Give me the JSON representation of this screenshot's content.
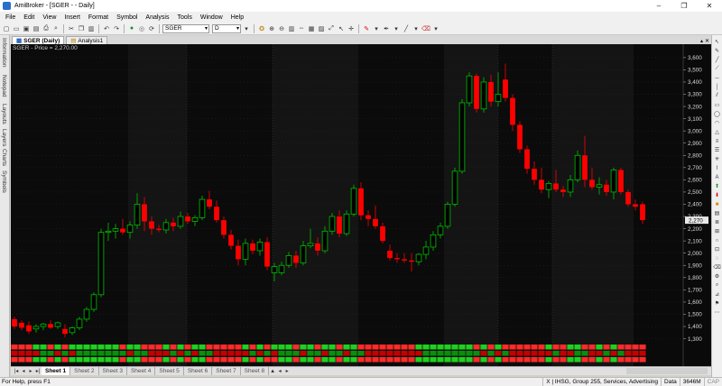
{
  "window": {
    "title": "AmiBroker - [SGER - - Daily]",
    "buttons": [
      "–",
      "❐",
      "✕"
    ]
  },
  "menu": [
    "File",
    "Edit",
    "View",
    "Insert",
    "Format",
    "Symbol",
    "Analysis",
    "Tools",
    "Window",
    "Help"
  ],
  "toolbar": {
    "symbol_value": "SGER",
    "interval_value": "D"
  },
  "left_dock": [
    "Information",
    "Notepad",
    "Layouts",
    "Layers",
    "Charts",
    "Symbols"
  ],
  "doc_tabs": [
    {
      "label": "SGER (Daily)",
      "active": true
    },
    {
      "label": "Analysis1",
      "active": false
    }
  ],
  "chart": {
    "title": "SGER - Price = 2,270.00",
    "last_price_label": "2,270",
    "colors": {
      "up": "#00c000",
      "down": "#ff0000",
      "background": "#0a0a0a"
    }
  },
  "chart_data": {
    "type": "candlestick",
    "title": "SGER - Price = 2,270.00",
    "ylim": [
      1260,
      3680
    ],
    "y_ticks": [
      "1,300",
      "1,400",
      "1,500",
      "1,600",
      "1,700",
      "1,800",
      "1,900",
      "2,000",
      "2,100",
      "2,200",
      "2,300",
      "2,400",
      "2,500",
      "2,600",
      "2,700",
      "2,800",
      "2,900",
      "3,000",
      "3,100",
      "3,200",
      "3,300",
      "3,400",
      "3,500",
      "3,600"
    ],
    "candles": [
      {
        "o": 1460,
        "h": 1480,
        "l": 1380,
        "c": 1400,
        "up": false
      },
      {
        "o": 1430,
        "h": 1450,
        "l": 1370,
        "c": 1390,
        "up": false
      },
      {
        "o": 1410,
        "h": 1440,
        "l": 1340,
        "c": 1360,
        "up": false
      },
      {
        "o": 1380,
        "h": 1420,
        "l": 1350,
        "c": 1400,
        "up": true
      },
      {
        "o": 1400,
        "h": 1430,
        "l": 1370,
        "c": 1420,
        "up": true
      },
      {
        "o": 1420,
        "h": 1450,
        "l": 1380,
        "c": 1390,
        "up": false
      },
      {
        "o": 1400,
        "h": 1440,
        "l": 1380,
        "c": 1430,
        "up": true
      },
      {
        "o": 1380,
        "h": 1420,
        "l": 1310,
        "c": 1340,
        "up": false
      },
      {
        "o": 1350,
        "h": 1400,
        "l": 1330,
        "c": 1390,
        "up": true
      },
      {
        "o": 1390,
        "h": 1480,
        "l": 1370,
        "c": 1460,
        "up": true
      },
      {
        "o": 1460,
        "h": 1560,
        "l": 1440,
        "c": 1540,
        "up": true
      },
      {
        "o": 1540,
        "h": 1680,
        "l": 1520,
        "c": 1660,
        "up": true
      },
      {
        "o": 1660,
        "h": 2200,
        "l": 1640,
        "c": 2170,
        "up": true
      },
      {
        "o": 2170,
        "h": 2250,
        "l": 2100,
        "c": 2180,
        "up": true
      },
      {
        "o": 2180,
        "h": 2240,
        "l": 2120,
        "c": 2200,
        "up": true
      },
      {
        "o": 2200,
        "h": 2280,
        "l": 2150,
        "c": 2170,
        "up": false
      },
      {
        "o": 2170,
        "h": 2260,
        "l": 2120,
        "c": 2230,
        "up": true
      },
      {
        "o": 2230,
        "h": 2490,
        "l": 2200,
        "c": 2400,
        "up": true
      },
      {
        "o": 2400,
        "h": 2460,
        "l": 2180,
        "c": 2260,
        "up": false
      },
      {
        "o": 2260,
        "h": 2300,
        "l": 2150,
        "c": 2200,
        "up": false
      },
      {
        "o": 2200,
        "h": 2230,
        "l": 2170,
        "c": 2190,
        "up": false
      },
      {
        "o": 2190,
        "h": 2280,
        "l": 2160,
        "c": 2250,
        "up": true
      },
      {
        "o": 2250,
        "h": 2290,
        "l": 2180,
        "c": 2220,
        "up": false
      },
      {
        "o": 2220,
        "h": 2340,
        "l": 2200,
        "c": 2300,
        "up": true
      },
      {
        "o": 2300,
        "h": 2330,
        "l": 2240,
        "c": 2260,
        "up": false
      },
      {
        "o": 2260,
        "h": 2310,
        "l": 2220,
        "c": 2290,
        "up": true
      },
      {
        "o": 2290,
        "h": 2470,
        "l": 2270,
        "c": 2440,
        "up": true
      },
      {
        "o": 2440,
        "h": 2510,
        "l": 2360,
        "c": 2380,
        "up": false
      },
      {
        "o": 2380,
        "h": 2430,
        "l": 2250,
        "c": 2270,
        "up": false
      },
      {
        "o": 2270,
        "h": 2300,
        "l": 2120,
        "c": 2150,
        "up": false
      },
      {
        "o": 2150,
        "h": 2190,
        "l": 2030,
        "c": 2060,
        "up": false
      },
      {
        "o": 2060,
        "h": 2110,
        "l": 1900,
        "c": 1950,
        "up": false
      },
      {
        "o": 1950,
        "h": 2120,
        "l": 1900,
        "c": 2080,
        "up": true
      },
      {
        "o": 2080,
        "h": 2110,
        "l": 1990,
        "c": 2020,
        "up": false
      },
      {
        "o": 2020,
        "h": 2120,
        "l": 1980,
        "c": 2090,
        "up": true
      },
      {
        "o": 2090,
        "h": 2130,
        "l": 1860,
        "c": 1890,
        "up": false
      },
      {
        "o": 1890,
        "h": 1920,
        "l": 1770,
        "c": 1840,
        "up": true
      },
      {
        "o": 1840,
        "h": 1930,
        "l": 1820,
        "c": 1900,
        "up": true
      },
      {
        "o": 1900,
        "h": 2010,
        "l": 1880,
        "c": 1980,
        "up": true
      },
      {
        "o": 1980,
        "h": 2020,
        "l": 1880,
        "c": 1920,
        "up": false
      },
      {
        "o": 1920,
        "h": 2100,
        "l": 1900,
        "c": 2060,
        "up": true
      },
      {
        "o": 2060,
        "h": 2200,
        "l": 2040,
        "c": 2080,
        "up": true
      },
      {
        "o": 2080,
        "h": 2130,
        "l": 1980,
        "c": 2020,
        "up": false
      },
      {
        "o": 2020,
        "h": 2220,
        "l": 2000,
        "c": 2180,
        "up": true
      },
      {
        "o": 2180,
        "h": 2330,
        "l": 2150,
        "c": 2300,
        "up": true
      },
      {
        "o": 2300,
        "h": 2350,
        "l": 2130,
        "c": 2160,
        "up": false
      },
      {
        "o": 2160,
        "h": 2350,
        "l": 2140,
        "c": 2320,
        "up": true
      },
      {
        "o": 2320,
        "h": 2560,
        "l": 2300,
        "c": 2530,
        "up": true
      },
      {
        "o": 2530,
        "h": 2580,
        "l": 2270,
        "c": 2310,
        "up": false
      },
      {
        "o": 2310,
        "h": 2350,
        "l": 2220,
        "c": 2280,
        "up": false
      },
      {
        "o": 2280,
        "h": 2390,
        "l": 2200,
        "c": 2220,
        "up": false
      },
      {
        "o": 2220,
        "h": 2250,
        "l": 2080,
        "c": 2100,
        "up": false
      },
      {
        "o": 2020,
        "h": 2070,
        "l": 1940,
        "c": 1960,
        "up": false
      },
      {
        "o": 1960,
        "h": 2000,
        "l": 1920,
        "c": 1950,
        "up": false
      },
      {
        "o": 1950,
        "h": 2000,
        "l": 1920,
        "c": 1940,
        "up": false
      },
      {
        "o": 1940,
        "h": 2000,
        "l": 1850,
        "c": 1930,
        "up": false
      },
      {
        "o": 1930,
        "h": 2000,
        "l": 1900,
        "c": 1990,
        "up": true
      },
      {
        "o": 1990,
        "h": 2100,
        "l": 1950,
        "c": 2050,
        "up": true
      },
      {
        "o": 2050,
        "h": 2180,
        "l": 2020,
        "c": 2150,
        "up": true
      },
      {
        "o": 2150,
        "h": 2250,
        "l": 2120,
        "c": 2220,
        "up": true
      },
      {
        "o": 2220,
        "h": 2420,
        "l": 2200,
        "c": 2400,
        "up": true
      },
      {
        "o": 2400,
        "h": 2700,
        "l": 2380,
        "c": 2670,
        "up": true
      },
      {
        "o": 2670,
        "h": 3260,
        "l": 2650,
        "c": 3230,
        "up": true
      },
      {
        "o": 3230,
        "h": 3480,
        "l": 3200,
        "c": 3450,
        "up": true
      },
      {
        "o": 3450,
        "h": 3470,
        "l": 3150,
        "c": 3180,
        "up": false
      },
      {
        "o": 3180,
        "h": 3440,
        "l": 3150,
        "c": 3400,
        "up": true
      },
      {
        "o": 3400,
        "h": 3460,
        "l": 3200,
        "c": 3240,
        "up": false
      },
      {
        "o": 3240,
        "h": 3480,
        "l": 3200,
        "c": 3300,
        "up": true
      },
      {
        "o": 3420,
        "h": 3550,
        "l": 3240,
        "c": 3270,
        "up": false
      },
      {
        "o": 3270,
        "h": 3300,
        "l": 3000,
        "c": 3050,
        "up": false
      },
      {
        "o": 3050,
        "h": 3080,
        "l": 2820,
        "c": 2850,
        "up": false
      },
      {
        "o": 2850,
        "h": 2880,
        "l": 2650,
        "c": 2690,
        "up": false
      },
      {
        "o": 2690,
        "h": 2750,
        "l": 2560,
        "c": 2600,
        "up": false
      },
      {
        "o": 2600,
        "h": 2700,
        "l": 2490,
        "c": 2520,
        "up": false
      },
      {
        "o": 2520,
        "h": 2590,
        "l": 2450,
        "c": 2570,
        "up": true
      },
      {
        "o": 2570,
        "h": 2680,
        "l": 2500,
        "c": 2520,
        "up": false
      },
      {
        "o": 2520,
        "h": 2550,
        "l": 2460,
        "c": 2500,
        "up": false
      },
      {
        "o": 2500,
        "h": 2640,
        "l": 2460,
        "c": 2600,
        "up": true
      },
      {
        "o": 2600,
        "h": 2840,
        "l": 2580,
        "c": 2800,
        "up": true
      },
      {
        "o": 2800,
        "h": 2960,
        "l": 2540,
        "c": 2600,
        "up": false
      },
      {
        "o": 2600,
        "h": 2700,
        "l": 2520,
        "c": 2540,
        "up": false
      },
      {
        "o": 2540,
        "h": 2620,
        "l": 2480,
        "c": 2560,
        "up": true
      },
      {
        "o": 2560,
        "h": 2600,
        "l": 2470,
        "c": 2500,
        "up": false
      },
      {
        "o": 2500,
        "h": 2700,
        "l": 2440,
        "c": 2680,
        "up": true
      },
      {
        "o": 2680,
        "h": 2700,
        "l": 2480,
        "c": 2500,
        "up": false
      },
      {
        "o": 2500,
        "h": 2520,
        "l": 2380,
        "c": 2400,
        "up": false
      },
      {
        "o": 2400,
        "h": 2440,
        "l": 2350,
        "c": 2380,
        "up": false
      },
      {
        "o": 2400,
        "h": 2420,
        "l": 2240,
        "c": 2270,
        "up": false
      }
    ]
  },
  "sheets": [
    "Sheet 1",
    "Sheet 2",
    "Sheet 3",
    "Sheet 4",
    "Sheet 5",
    "Sheet 6",
    "Sheet 7",
    "Sheet 8"
  ],
  "status": {
    "help": "For Help, press F1",
    "group": "X | IHSG, Group 255, Services, Advertising",
    "data": "Data",
    "memory": "3646M",
    "caps": "CAP"
  }
}
